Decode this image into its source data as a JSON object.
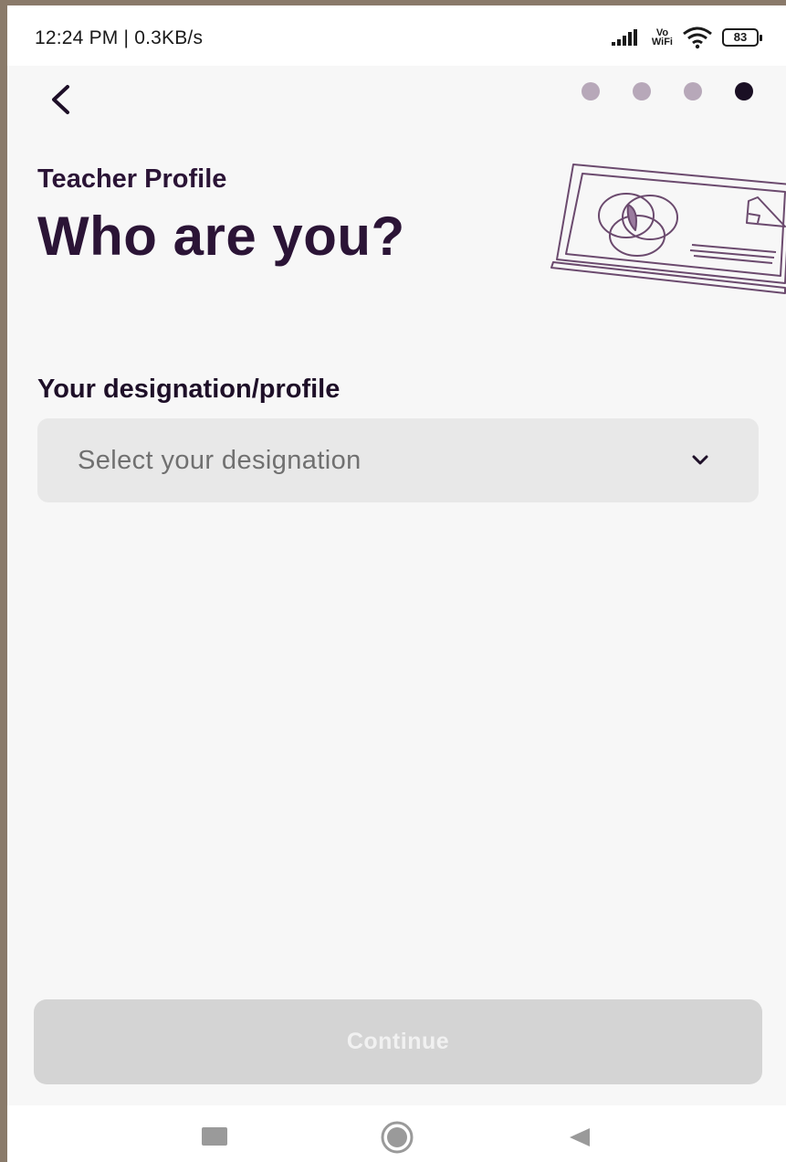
{
  "status_bar": {
    "time": "12:24 PM | 0.3KB/s",
    "vowifi_line1": "Vo",
    "vowifi_line2": "WiFi",
    "battery": "83"
  },
  "header": {
    "back_icon": "chevron-left-icon",
    "progress": {
      "total_steps": 4,
      "current_step": 4
    }
  },
  "page": {
    "eyebrow": "Teacher Profile",
    "title": "Who are you?",
    "illustration": "whiteboard-venn-diagram-illustration"
  },
  "form": {
    "designation_label": "Your designation/profile",
    "designation_placeholder": "Select your designation",
    "designation_icon": "chevron-down-icon"
  },
  "footer": {
    "continue_label": "Continue"
  },
  "nav_bar": {
    "items": [
      "recents-icon",
      "home-icon",
      "back-icon"
    ]
  },
  "colors": {
    "primary_text": "#2b1436",
    "dot_inactive": "#b7a8b9",
    "dot_active": "#1a0f24",
    "field_bg": "#e8e8e8",
    "button_disabled": "#d4d4d4"
  }
}
